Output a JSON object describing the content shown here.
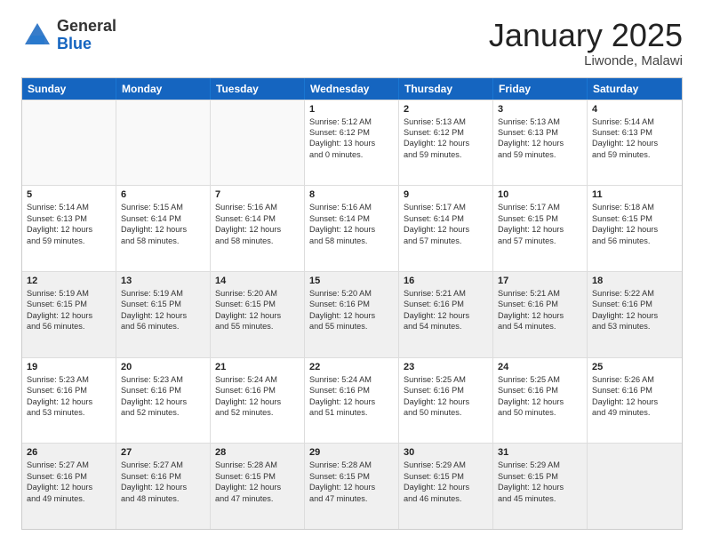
{
  "logo": {
    "general": "General",
    "blue": "Blue"
  },
  "header": {
    "month": "January 2025",
    "location": "Liwonde, Malawi"
  },
  "weekdays": [
    "Sunday",
    "Monday",
    "Tuesday",
    "Wednesday",
    "Thursday",
    "Friday",
    "Saturday"
  ],
  "rows": [
    [
      {
        "day": "",
        "lines": [],
        "empty": true
      },
      {
        "day": "",
        "lines": [],
        "empty": true
      },
      {
        "day": "",
        "lines": [],
        "empty": true
      },
      {
        "day": "1",
        "lines": [
          "Sunrise: 5:12 AM",
          "Sunset: 6:12 PM",
          "Daylight: 13 hours",
          "and 0 minutes."
        ]
      },
      {
        "day": "2",
        "lines": [
          "Sunrise: 5:13 AM",
          "Sunset: 6:12 PM",
          "Daylight: 12 hours",
          "and 59 minutes."
        ]
      },
      {
        "day": "3",
        "lines": [
          "Sunrise: 5:13 AM",
          "Sunset: 6:13 PM",
          "Daylight: 12 hours",
          "and 59 minutes."
        ]
      },
      {
        "day": "4",
        "lines": [
          "Sunrise: 5:14 AM",
          "Sunset: 6:13 PM",
          "Daylight: 12 hours",
          "and 59 minutes."
        ]
      }
    ],
    [
      {
        "day": "5",
        "lines": [
          "Sunrise: 5:14 AM",
          "Sunset: 6:13 PM",
          "Daylight: 12 hours",
          "and 59 minutes."
        ]
      },
      {
        "day": "6",
        "lines": [
          "Sunrise: 5:15 AM",
          "Sunset: 6:14 PM",
          "Daylight: 12 hours",
          "and 58 minutes."
        ]
      },
      {
        "day": "7",
        "lines": [
          "Sunrise: 5:16 AM",
          "Sunset: 6:14 PM",
          "Daylight: 12 hours",
          "and 58 minutes."
        ]
      },
      {
        "day": "8",
        "lines": [
          "Sunrise: 5:16 AM",
          "Sunset: 6:14 PM",
          "Daylight: 12 hours",
          "and 58 minutes."
        ]
      },
      {
        "day": "9",
        "lines": [
          "Sunrise: 5:17 AM",
          "Sunset: 6:14 PM",
          "Daylight: 12 hours",
          "and 57 minutes."
        ]
      },
      {
        "day": "10",
        "lines": [
          "Sunrise: 5:17 AM",
          "Sunset: 6:15 PM",
          "Daylight: 12 hours",
          "and 57 minutes."
        ]
      },
      {
        "day": "11",
        "lines": [
          "Sunrise: 5:18 AM",
          "Sunset: 6:15 PM",
          "Daylight: 12 hours",
          "and 56 minutes."
        ]
      }
    ],
    [
      {
        "day": "12",
        "lines": [
          "Sunrise: 5:19 AM",
          "Sunset: 6:15 PM",
          "Daylight: 12 hours",
          "and 56 minutes."
        ],
        "shaded": true
      },
      {
        "day": "13",
        "lines": [
          "Sunrise: 5:19 AM",
          "Sunset: 6:15 PM",
          "Daylight: 12 hours",
          "and 56 minutes."
        ],
        "shaded": true
      },
      {
        "day": "14",
        "lines": [
          "Sunrise: 5:20 AM",
          "Sunset: 6:15 PM",
          "Daylight: 12 hours",
          "and 55 minutes."
        ],
        "shaded": true
      },
      {
        "day": "15",
        "lines": [
          "Sunrise: 5:20 AM",
          "Sunset: 6:16 PM",
          "Daylight: 12 hours",
          "and 55 minutes."
        ],
        "shaded": true
      },
      {
        "day": "16",
        "lines": [
          "Sunrise: 5:21 AM",
          "Sunset: 6:16 PM",
          "Daylight: 12 hours",
          "and 54 minutes."
        ],
        "shaded": true
      },
      {
        "day": "17",
        "lines": [
          "Sunrise: 5:21 AM",
          "Sunset: 6:16 PM",
          "Daylight: 12 hours",
          "and 54 minutes."
        ],
        "shaded": true
      },
      {
        "day": "18",
        "lines": [
          "Sunrise: 5:22 AM",
          "Sunset: 6:16 PM",
          "Daylight: 12 hours",
          "and 53 minutes."
        ],
        "shaded": true
      }
    ],
    [
      {
        "day": "19",
        "lines": [
          "Sunrise: 5:23 AM",
          "Sunset: 6:16 PM",
          "Daylight: 12 hours",
          "and 53 minutes."
        ]
      },
      {
        "day": "20",
        "lines": [
          "Sunrise: 5:23 AM",
          "Sunset: 6:16 PM",
          "Daylight: 12 hours",
          "and 52 minutes."
        ]
      },
      {
        "day": "21",
        "lines": [
          "Sunrise: 5:24 AM",
          "Sunset: 6:16 PM",
          "Daylight: 12 hours",
          "and 52 minutes."
        ]
      },
      {
        "day": "22",
        "lines": [
          "Sunrise: 5:24 AM",
          "Sunset: 6:16 PM",
          "Daylight: 12 hours",
          "and 51 minutes."
        ]
      },
      {
        "day": "23",
        "lines": [
          "Sunrise: 5:25 AM",
          "Sunset: 6:16 PM",
          "Daylight: 12 hours",
          "and 50 minutes."
        ]
      },
      {
        "day": "24",
        "lines": [
          "Sunrise: 5:25 AM",
          "Sunset: 6:16 PM",
          "Daylight: 12 hours",
          "and 50 minutes."
        ]
      },
      {
        "day": "25",
        "lines": [
          "Sunrise: 5:26 AM",
          "Sunset: 6:16 PM",
          "Daylight: 12 hours",
          "and 49 minutes."
        ]
      }
    ],
    [
      {
        "day": "26",
        "lines": [
          "Sunrise: 5:27 AM",
          "Sunset: 6:16 PM",
          "Daylight: 12 hours",
          "and 49 minutes."
        ],
        "shaded": true
      },
      {
        "day": "27",
        "lines": [
          "Sunrise: 5:27 AM",
          "Sunset: 6:16 PM",
          "Daylight: 12 hours",
          "and 48 minutes."
        ],
        "shaded": true
      },
      {
        "day": "28",
        "lines": [
          "Sunrise: 5:28 AM",
          "Sunset: 6:15 PM",
          "Daylight: 12 hours",
          "and 47 minutes."
        ],
        "shaded": true
      },
      {
        "day": "29",
        "lines": [
          "Sunrise: 5:28 AM",
          "Sunset: 6:15 PM",
          "Daylight: 12 hours",
          "and 47 minutes."
        ],
        "shaded": true
      },
      {
        "day": "30",
        "lines": [
          "Sunrise: 5:29 AM",
          "Sunset: 6:15 PM",
          "Daylight: 12 hours",
          "and 46 minutes."
        ],
        "shaded": true
      },
      {
        "day": "31",
        "lines": [
          "Sunrise: 5:29 AM",
          "Sunset: 6:15 PM",
          "Daylight: 12 hours",
          "and 45 minutes."
        ],
        "shaded": true
      },
      {
        "day": "",
        "lines": [],
        "empty": true,
        "shaded": true
      }
    ]
  ]
}
